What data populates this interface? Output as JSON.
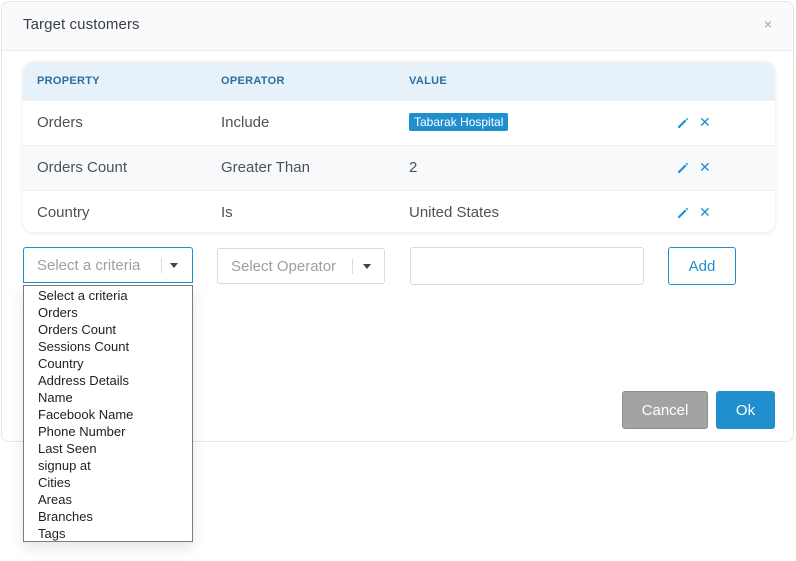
{
  "modal": {
    "title": "Target customers",
    "close_glyph": "×"
  },
  "table": {
    "headers": {
      "property": "PROPERTY",
      "operator": "OPERATOR",
      "value": "VALUE"
    },
    "rows": [
      {
        "property": "Orders",
        "operator": "Include",
        "value": "Tabarak Hospital",
        "value_is_tag": true
      },
      {
        "property": "Orders Count",
        "operator": "Greater Than",
        "value": "2",
        "value_is_tag": false
      },
      {
        "property": "Country",
        "operator": "Is",
        "value": "United States",
        "value_is_tag": false
      }
    ],
    "row_icons": {
      "edit": "pencil-icon",
      "delete": "close-icon"
    },
    "delete_glyph": "✕"
  },
  "form": {
    "criteria_placeholder": "Select a criteria",
    "operator_placeholder": "Select Operator",
    "value_input": "",
    "add_label": "Add"
  },
  "dropdown_options": [
    "Select a criteria",
    "Orders",
    "Orders Count",
    "Sessions Count",
    "Country",
    "Address Details",
    "Name",
    "Facebook Name",
    "Phone Number",
    "Last Seen",
    "signup at",
    "Cities",
    "Areas",
    "Branches",
    "Tags"
  ],
  "footer": {
    "cancel_label": "Cancel",
    "ok_label": "Ok"
  },
  "colors": {
    "accent": "#1f8fce",
    "header_bg": "#e7f1fa",
    "cancel_bg": "#a3a3a3"
  }
}
